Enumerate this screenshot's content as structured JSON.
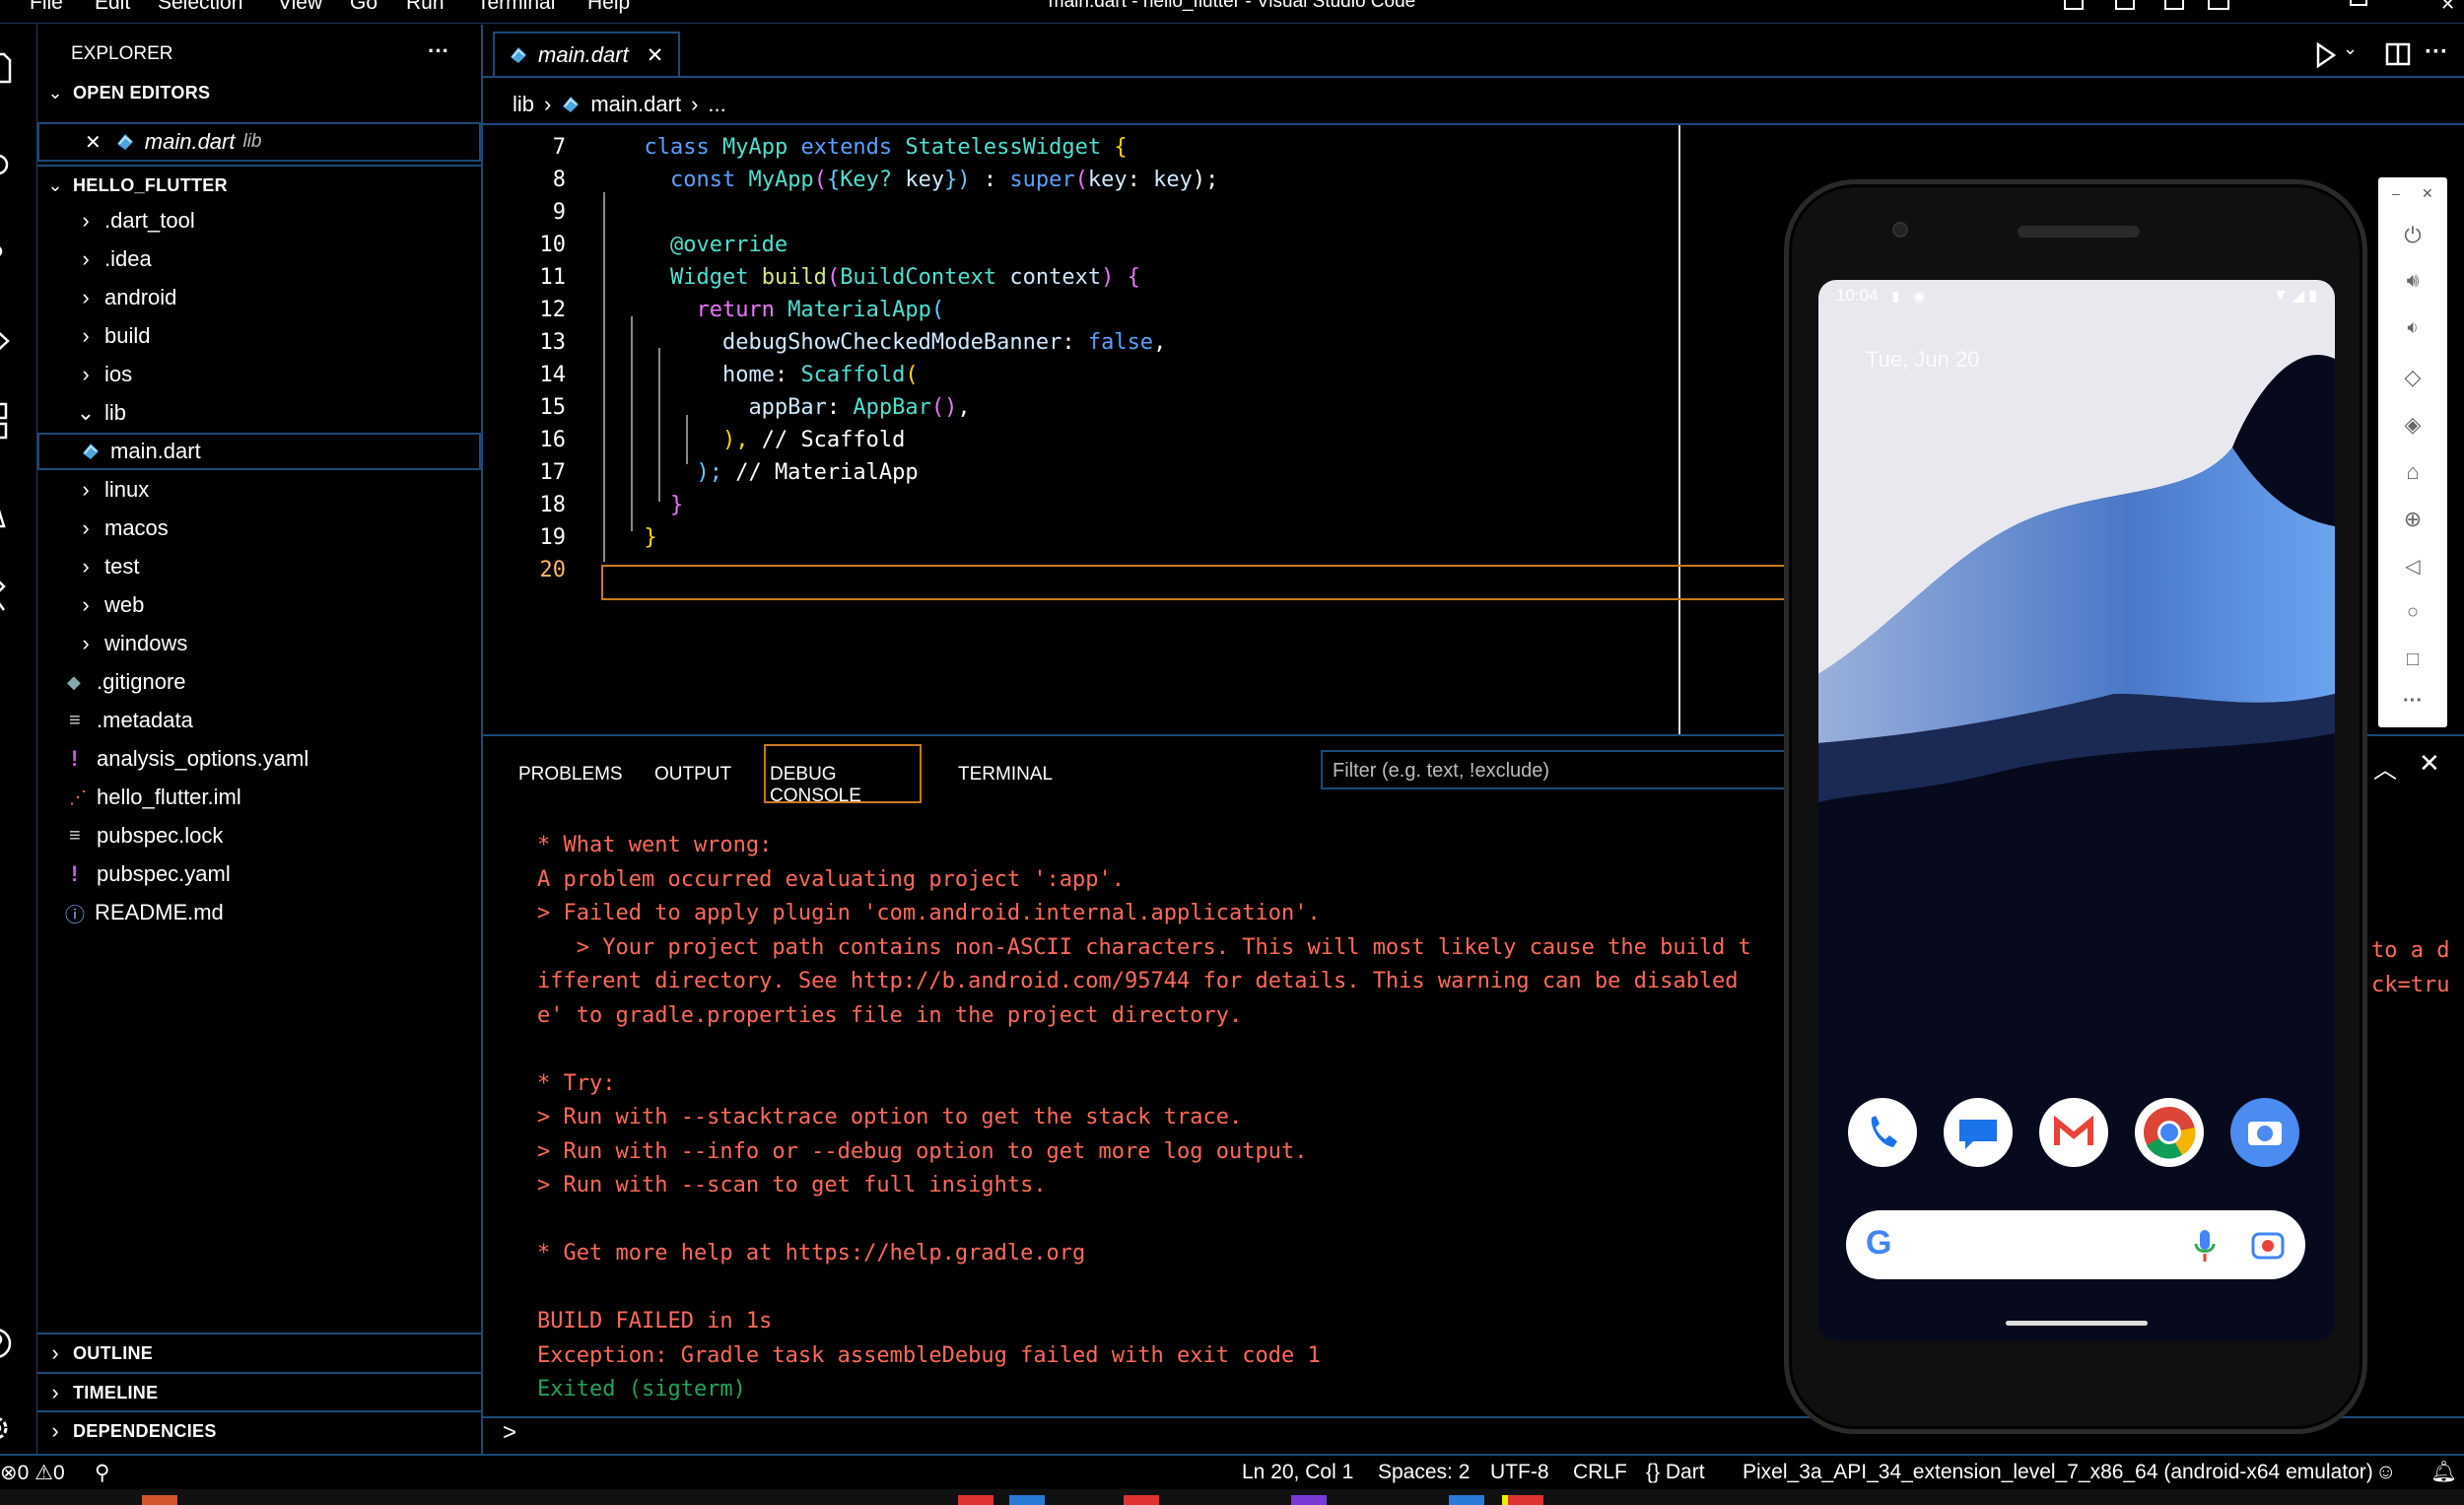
{
  "titlebar": {
    "menu": [
      "File",
      "Edit",
      "Selection",
      "View",
      "Go",
      "Run",
      "Terminal",
      "Help"
    ],
    "title": "main.dart - hello_flutter - Visual Studio Code"
  },
  "sidebar": {
    "header": "EXPLORER",
    "more": "···",
    "open_editors": {
      "label": "OPEN EDITORS",
      "file": "main.dart",
      "folder": "lib"
    },
    "project": {
      "label": "HELLO_FLUTTER",
      "items": [
        {
          "label": ".dart_tool",
          "kind": "folder"
        },
        {
          "label": ".idea",
          "kind": "folder"
        },
        {
          "label": "android",
          "kind": "folder"
        },
        {
          "label": "build",
          "kind": "folder"
        },
        {
          "label": "ios",
          "kind": "folder"
        },
        {
          "label": "lib",
          "kind": "folder-open"
        },
        {
          "label": "main.dart",
          "kind": "dart"
        },
        {
          "label": "linux",
          "kind": "folder"
        },
        {
          "label": "macos",
          "kind": "folder"
        },
        {
          "label": "test",
          "kind": "folder"
        },
        {
          "label": "web",
          "kind": "folder"
        },
        {
          "label": "windows",
          "kind": "folder"
        },
        {
          "label": ".gitignore",
          "kind": "git"
        },
        {
          "label": ".metadata",
          "kind": "lines"
        },
        {
          "label": "analysis_options.yaml",
          "kind": "yaml"
        },
        {
          "label": "hello_flutter.iml",
          "kind": "rss"
        },
        {
          "label": "pubspec.lock",
          "kind": "lines"
        },
        {
          "label": "pubspec.yaml",
          "kind": "yaml"
        },
        {
          "label": "README.md",
          "kind": "info"
        }
      ]
    },
    "outline": "OUTLINE",
    "timeline": "TIMELINE",
    "dependencies": "DEPENDENCIES"
  },
  "editor": {
    "tab": "main.dart",
    "breadcrumb": {
      "folder": "lib",
      "file": "main.dart",
      "more": "..."
    },
    "lines": [
      {
        "n": "7"
      },
      {
        "n": "8"
      },
      {
        "n": "9"
      },
      {
        "n": "10"
      },
      {
        "n": "11"
      },
      {
        "n": "12"
      },
      {
        "n": "13"
      },
      {
        "n": "14"
      },
      {
        "n": "15"
      },
      {
        "n": "16"
      },
      {
        "n": "17"
      },
      {
        "n": "18"
      },
      {
        "n": "19"
      },
      {
        "n": "20"
      }
    ],
    "code": {
      "l7": [
        "class",
        "MyApp",
        "extends",
        "StatelessWidget",
        "{"
      ],
      "l8": [
        "const",
        "MyApp",
        "(",
        "{",
        "Key?",
        "key",
        "})",
        ":",
        "super",
        "(",
        "key",
        ":",
        "key",
        ");"
      ],
      "l10": "@override",
      "l11": [
        "Widget",
        "build",
        "(",
        "BuildContext",
        "context",
        ")",
        "{"
      ],
      "l12": [
        "return",
        "MaterialApp",
        "("
      ],
      "l13": [
        "debugShowCheckedModeBanner",
        ":",
        "false",
        ","
      ],
      "l14": [
        "home",
        ":",
        "Scaffold",
        "("
      ],
      "l15": [
        "appBar",
        ":",
        "AppBar",
        "()",
        ","
      ],
      "l16": [
        "),",
        "// Scaffold"
      ],
      "l17": [
        ");",
        "// MaterialApp"
      ],
      "l18": "}",
      "l19": "}"
    }
  },
  "panel": {
    "tabs": [
      "PROBLEMS",
      "OUTPUT",
      "DEBUG CONSOLE",
      "TERMINAL"
    ],
    "filter_placeholder": "Filter (e.g. text, !exclude)",
    "output": [
      {
        "text": "* What went wrong:",
        "cls": "err"
      },
      {
        "text": "A problem occurred evaluating project ':app'.",
        "cls": "err"
      },
      {
        "text": "> Failed to apply plugin 'com.android.internal.application'.",
        "cls": "err"
      },
      {
        "text": "   > Your project path contains non-ASCII characters. This will most likely cause the build t",
        "cls": "err"
      },
      {
        "text": "ifferent directory. See http://b.android.com/95744 for details. This warning can be disabled",
        "cls": "err"
      },
      {
        "text": "e' to gradle.properties file in the project directory.",
        "cls": "err"
      },
      {
        "text": "",
        "cls": "err"
      },
      {
        "text": "* Try:",
        "cls": "err"
      },
      {
        "text": "> Run with --stacktrace option to get the stack trace.",
        "cls": "err"
      },
      {
        "text": "> Run with --info or --debug option to get more log output.",
        "cls": "err"
      },
      {
        "text": "> Run with --scan to get full insights.",
        "cls": "err"
      },
      {
        "text": "",
        "cls": "err"
      },
      {
        "text": "* Get more help at https://help.gradle.org",
        "cls": "err"
      },
      {
        "text": "",
        "cls": "err"
      },
      {
        "text": "BUILD FAILED in 1s",
        "cls": "err"
      },
      {
        "text": "Exception: Gradle task assembleDebug failed with exit code 1",
        "cls": "err"
      },
      {
        "text": "Exited (sigterm)",
        "cls": "ok"
      }
    ],
    "overflow_right_1": "to a d",
    "overflow_right_2": "ck=tru",
    "prompt": ">"
  },
  "statusbar": {
    "errors": "0",
    "warnings": "0",
    "position": "Ln 20, Col 1",
    "spaces": "Spaces: 2",
    "encoding": "UTF-8",
    "eol": "CRLF",
    "language": "Dart",
    "device": "Pixel_3a_API_34_extension_level_7_x86_64 (android-x64 emulator)"
  },
  "phone": {
    "time": "10:04",
    "date": "Tue, Jun 20",
    "dock_apps": [
      "phone-app",
      "messages-app",
      "gmail-app",
      "chrome-app",
      "camera-app"
    ]
  },
  "colors": {
    "accent_border": "#1a4a78",
    "error_text": "#ff6a5a",
    "success_text": "#22a35a",
    "line_highlight": "#c97a1c",
    "keyword": "#5aa0ff",
    "type": "#4fe0d0",
    "function": "#d7e77d"
  }
}
